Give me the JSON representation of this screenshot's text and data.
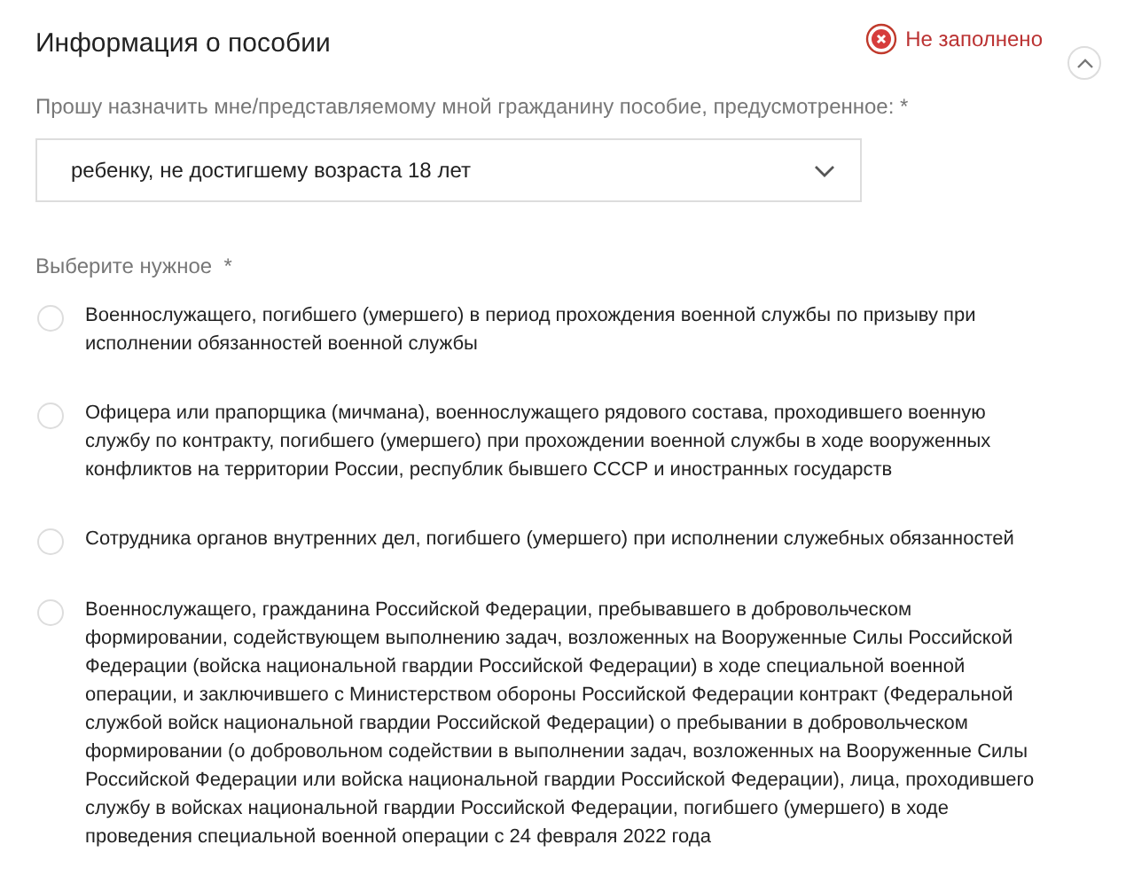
{
  "section": {
    "title": "Информация о пособии",
    "status": "Не заполнено",
    "expanded": true
  },
  "benefit_field": {
    "label": "Прошу назначить мне/представляемому мной гражданину пособие, предусмотренное:",
    "required_mark": "*",
    "value": "ребенку, не достигшему возраста 18 лет"
  },
  "choice_group": {
    "label": "Выберите нужное",
    "required_mark": "*",
    "options": [
      {
        "text": "Военнослужащего, погибшего (умершего) в период прохождения военной службы по призыву при исполнении обязанностей военной службы",
        "selected": false
      },
      {
        "text": "Офицера или прапорщика (мичмана), военнослужащего рядового состава, проходившего военную службу по контракту, погибшего (умершего) при прохождении военной службы в ходе вооруженных конфликтов на территории России, республик бывшего СССР и иностранных государств",
        "selected": false
      },
      {
        "text": "Сотрудника органов внутренних дел, погибшего (умершего) при исполнении служебных обязанностей",
        "selected": false
      },
      {
        "text": "Военнослужащего, гражданина Российской Федерации, пребывавшего в добровольческом формировании, содействующем выполнению задач, возложенных на Вооруженные Силы Российской Федерации (войска национальной гвардии Российской Федерации) в ходе специальной военной операции, и заключившего с Министерством обороны Российской Федерации контракт (Федеральной службой войск национальной гвардии Российской Федерации) о пребывании в добровольческом формировании (о добровольном содействии в выполнении задач, возложенных на Вооруженные Силы Российской Федерации или войска национальной гвардии Российской Федерации), лица, проходившего службу в войсках национальной гвардии Российской Федерации, погибшего (умершего) в ходе проведения специальной военной операции с 24 февраля 2022 года",
        "selected": false
      }
    ]
  }
}
